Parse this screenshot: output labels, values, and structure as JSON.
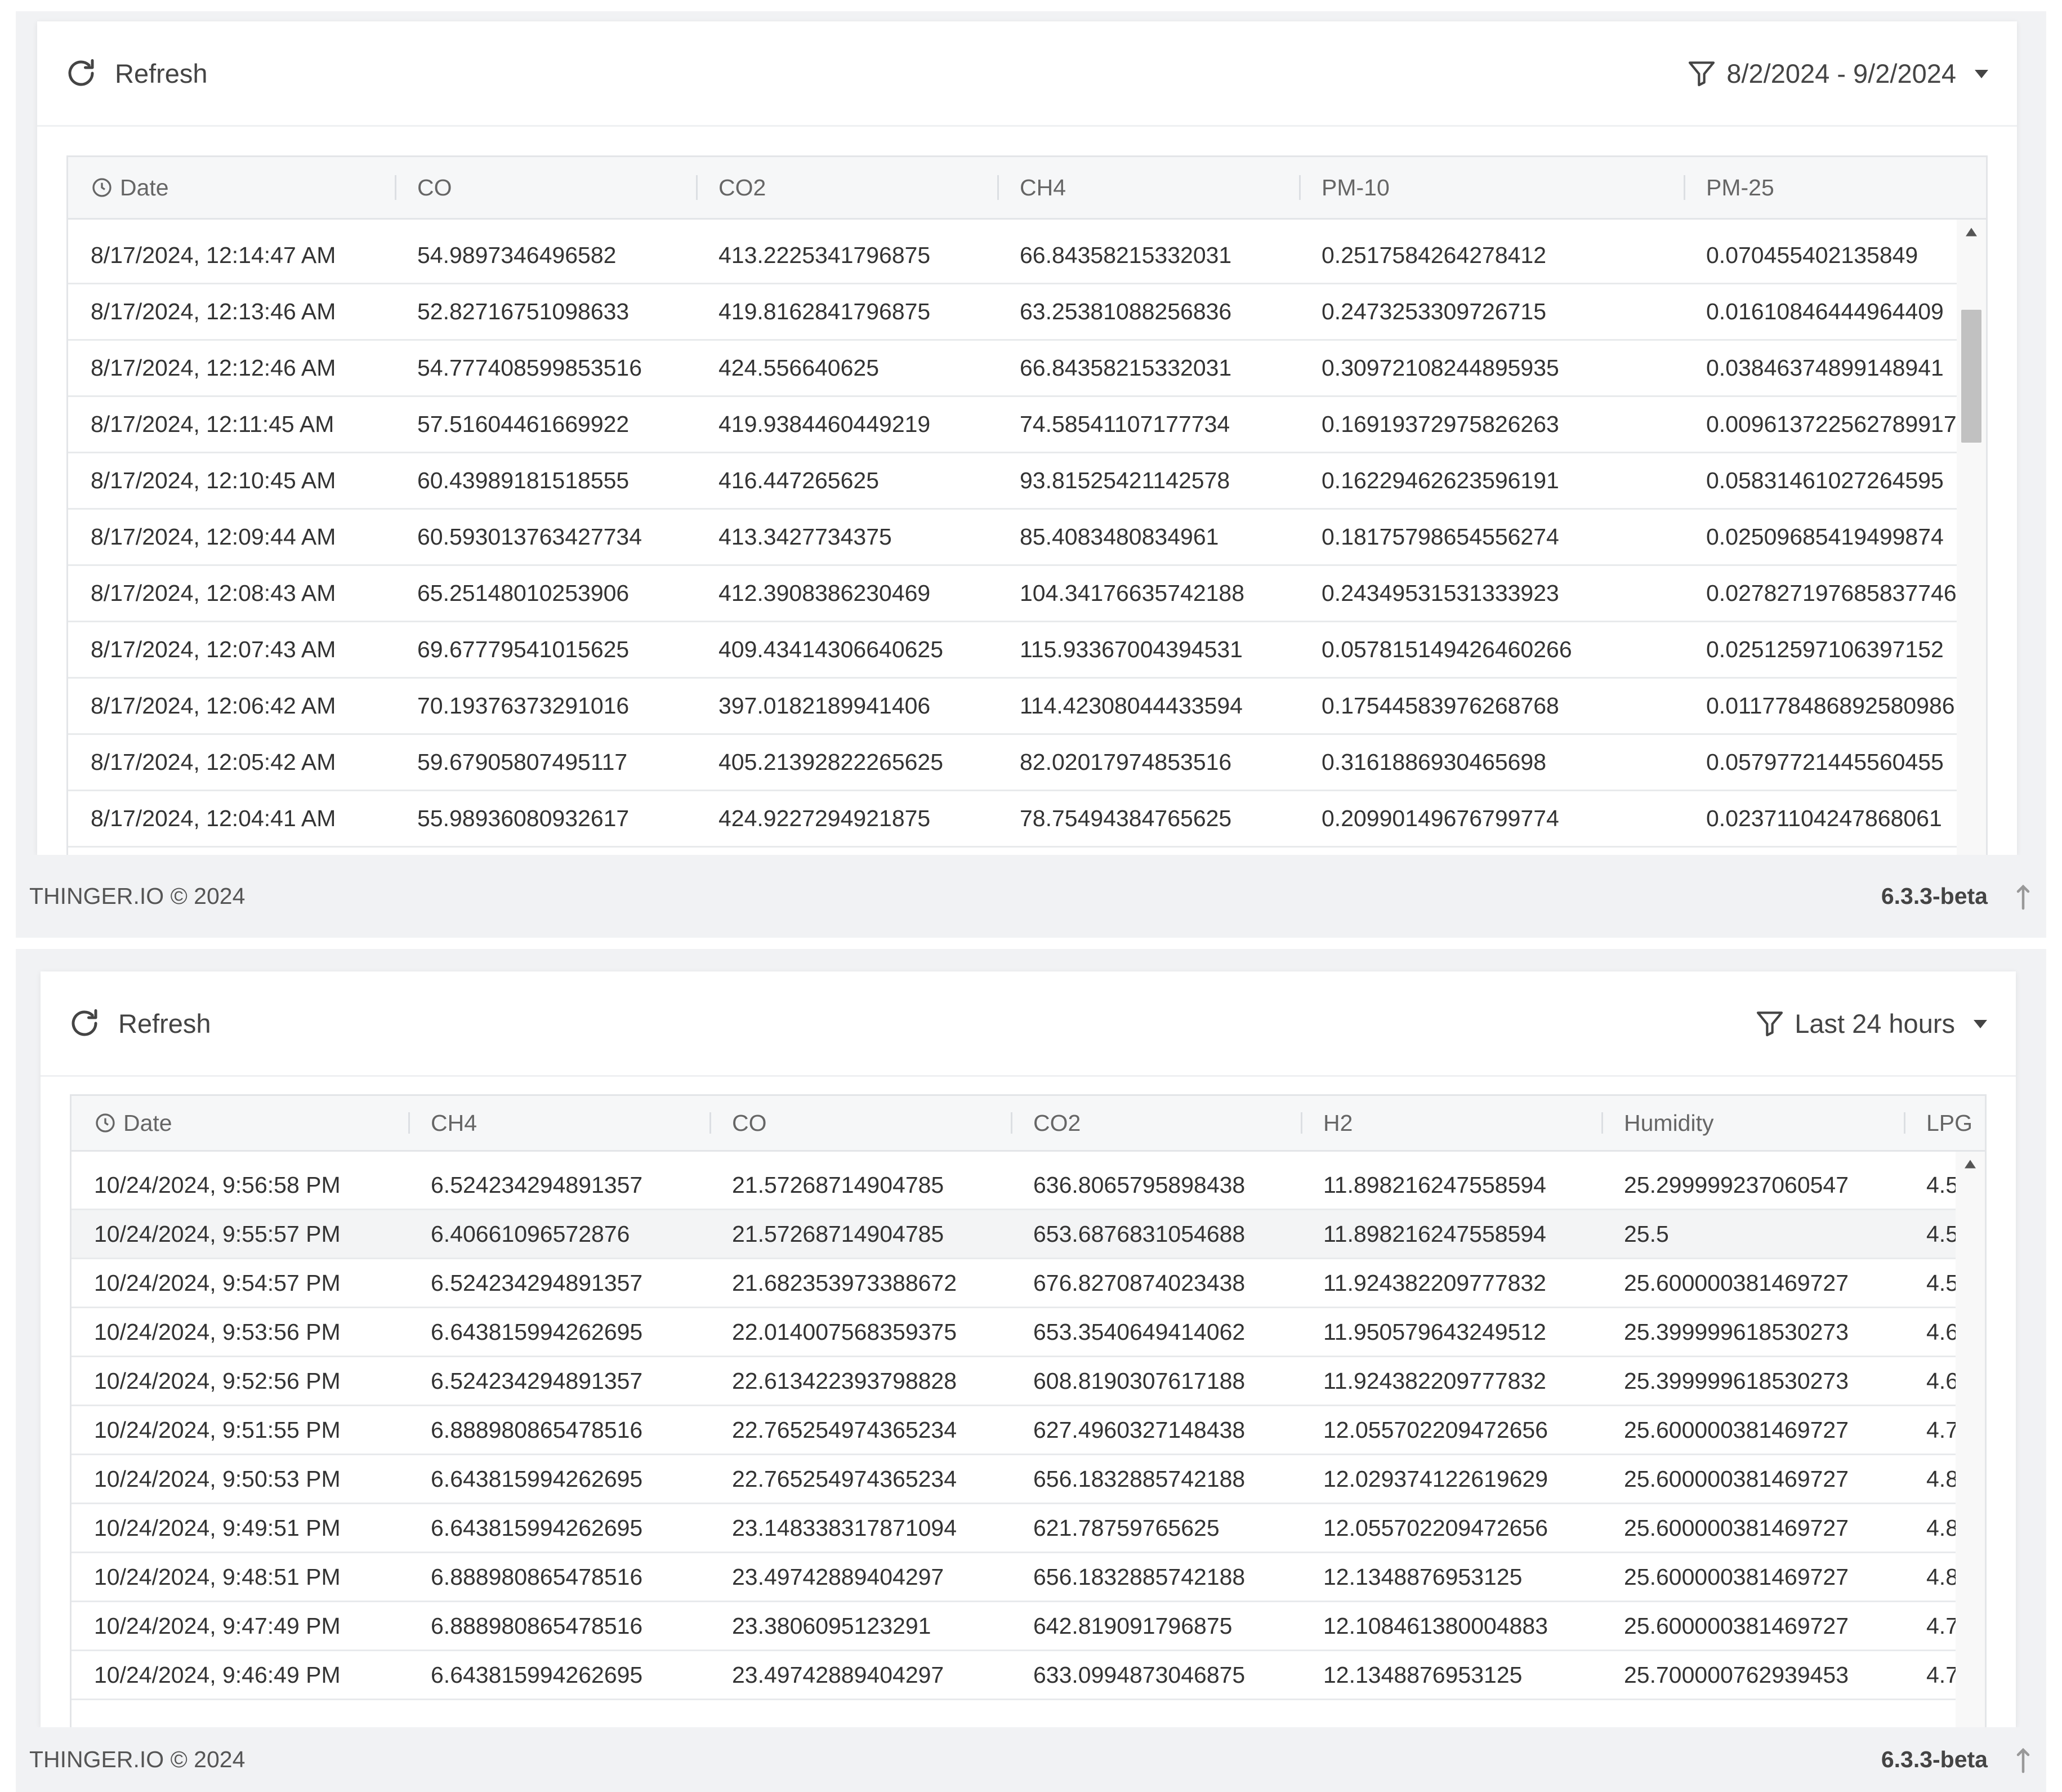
{
  "panel1": {
    "refresh_label": "Refresh",
    "filter_label": "8/2/2024 - 9/2/2024",
    "columns": [
      "Date",
      "CO",
      "CO2",
      "CH4",
      "PM-10",
      "PM-25"
    ],
    "rows": [
      [
        "8/17/2024, 12:14:47 AM",
        "54.9897346496582",
        "413.2225341796875",
        "66.84358215332031",
        "0.2517584264278412",
        "0.070455402135849"
      ],
      [
        "8/17/2024, 12:13:46 AM",
        "52.82716751098633",
        "419.8162841796875",
        "63.25381088256836",
        "0.2473253309726715",
        "0.01610846444964409"
      ],
      [
        "8/17/2024, 12:12:46 AM",
        "54.777408599853516",
        "424.556640625",
        "66.84358215332031",
        "0.30972108244895935",
        "0.03846374899148941"
      ],
      [
        "8/17/2024, 12:11:45 AM",
        "57.51604461669922",
        "419.9384460449219",
        "74.58541107177734",
        "0.16919372975826263",
        "0.009613722562789917"
      ],
      [
        "8/17/2024, 12:10:45 AM",
        "60.43989181518555",
        "416.447265625",
        "93.81525421142578",
        "0.16229462623596191",
        "0.05831461027264595"
      ],
      [
        "8/17/2024, 12:09:44 AM",
        "60.593013763427734",
        "413.3427734375",
        "85.4083480834961",
        "0.18175798654556274",
        "0.02509685419499874"
      ],
      [
        "8/17/2024, 12:08:43 AM",
        "65.25148010253906",
        "412.3908386230469",
        "104.34176635742188",
        "0.24349531531333923",
        "0.027827197685837746"
      ],
      [
        "8/17/2024, 12:07:43 AM",
        "69.67779541015625",
        "409.43414306640625",
        "115.93367004394531",
        "0.057815149426460266",
        "0.02512597106397152"
      ],
      [
        "8/17/2024, 12:06:42 AM",
        "70.19376373291016",
        "397.0182189941406",
        "114.42308044433594",
        "0.17544583976268768",
        "0.011778486892580986"
      ],
      [
        "8/17/2024, 12:05:42 AM",
        "59.67905807495117",
        "405.21392822265625",
        "82.02017974853516",
        "0.3161886930465698",
        "0.05797721445560455"
      ],
      [
        "8/17/2024, 12:04:41 AM",
        "55.98936080932617",
        "424.9227294921875",
        "78.75494384765625",
        "0.20990149676799774",
        "0.02371104247868061"
      ]
    ],
    "footer_copy": "THINGER.IO © 2024",
    "footer_version": "6.3.3-beta"
  },
  "panel2": {
    "refresh_label": "Refresh",
    "filter_label": "Last 24 hours",
    "columns": [
      "Date",
      "CH4",
      "CO",
      "CO2",
      "H2",
      "Humidity",
      "LPG"
    ],
    "rows": [
      [
        "10/24/2024, 9:56:58 PM",
        "6.524234294891357",
        "21.57268714904785",
        "636.8065795898438",
        "11.898216247558594",
        "25.299999237060547",
        "4.5"
      ],
      [
        "10/24/2024, 9:55:57 PM",
        "6.40661096572876",
        "21.57268714904785",
        "653.6876831054688",
        "11.898216247558594",
        "25.5",
        "4.5"
      ],
      [
        "10/24/2024, 9:54:57 PM",
        "6.524234294891357",
        "21.682353973388672",
        "676.8270874023438",
        "11.924382209777832",
        "25.600000381469727",
        "4.5"
      ],
      [
        "10/24/2024, 9:53:56 PM",
        "6.643815994262695",
        "22.014007568359375",
        "653.3540649414062",
        "11.950579643249512",
        "25.399999618530273",
        "4.6"
      ],
      [
        "10/24/2024, 9:52:56 PM",
        "6.524234294891357",
        "22.613422393798828",
        "608.8190307617188",
        "11.924382209777832",
        "25.399999618530273",
        "4.6"
      ],
      [
        "10/24/2024, 9:51:55 PM",
        "6.888980865478516",
        "22.765254974365234",
        "627.4960327148438",
        "12.055702209472656",
        "25.600000381469727",
        "4.7"
      ],
      [
        "10/24/2024, 9:50:53 PM",
        "6.643815994262695",
        "22.765254974365234",
        "656.1832885742188",
        "12.029374122619629",
        "25.600000381469727",
        "4.8"
      ],
      [
        "10/24/2024, 9:49:51 PM",
        "6.643815994262695",
        "23.148338317871094",
        "621.78759765625",
        "12.055702209472656",
        "25.600000381469727",
        "4.8"
      ],
      [
        "10/24/2024, 9:48:51 PM",
        "6.888980865478516",
        "23.49742889404297",
        "656.1832885742188",
        "12.1348876953125",
        "25.600000381469727",
        "4.8"
      ],
      [
        "10/24/2024, 9:47:49 PM",
        "6.888980865478516",
        "23.3806095123291",
        "642.819091796875",
        "12.108461380004883",
        "25.600000381469727",
        "4.7"
      ],
      [
        "10/24/2024, 9:46:49 PM",
        "6.643815994262695",
        "23.49742889404297",
        "633.0994873046875",
        "12.1348876953125",
        "25.700000762939453",
        "4.7"
      ]
    ],
    "highlighted_row": 1,
    "footer_copy": "THINGER.IO © 2024",
    "footer_version": "6.3.3-beta"
  },
  "icons": {
    "refresh": "refresh-icon",
    "filter": "filter-icon",
    "caret": "caret-down-icon",
    "clock": "clock-icon",
    "scroll_up": "scroll-up-arrow-icon",
    "back_to_top": "arrow-up-icon"
  },
  "colors": {
    "page_bg": "#f1f2f4",
    "card_bg": "#ffffff",
    "header_bg": "#f6f7f8",
    "row_border": "#e8eaec",
    "scroll_thumb": "#c1c1c1",
    "text": "#333333"
  }
}
